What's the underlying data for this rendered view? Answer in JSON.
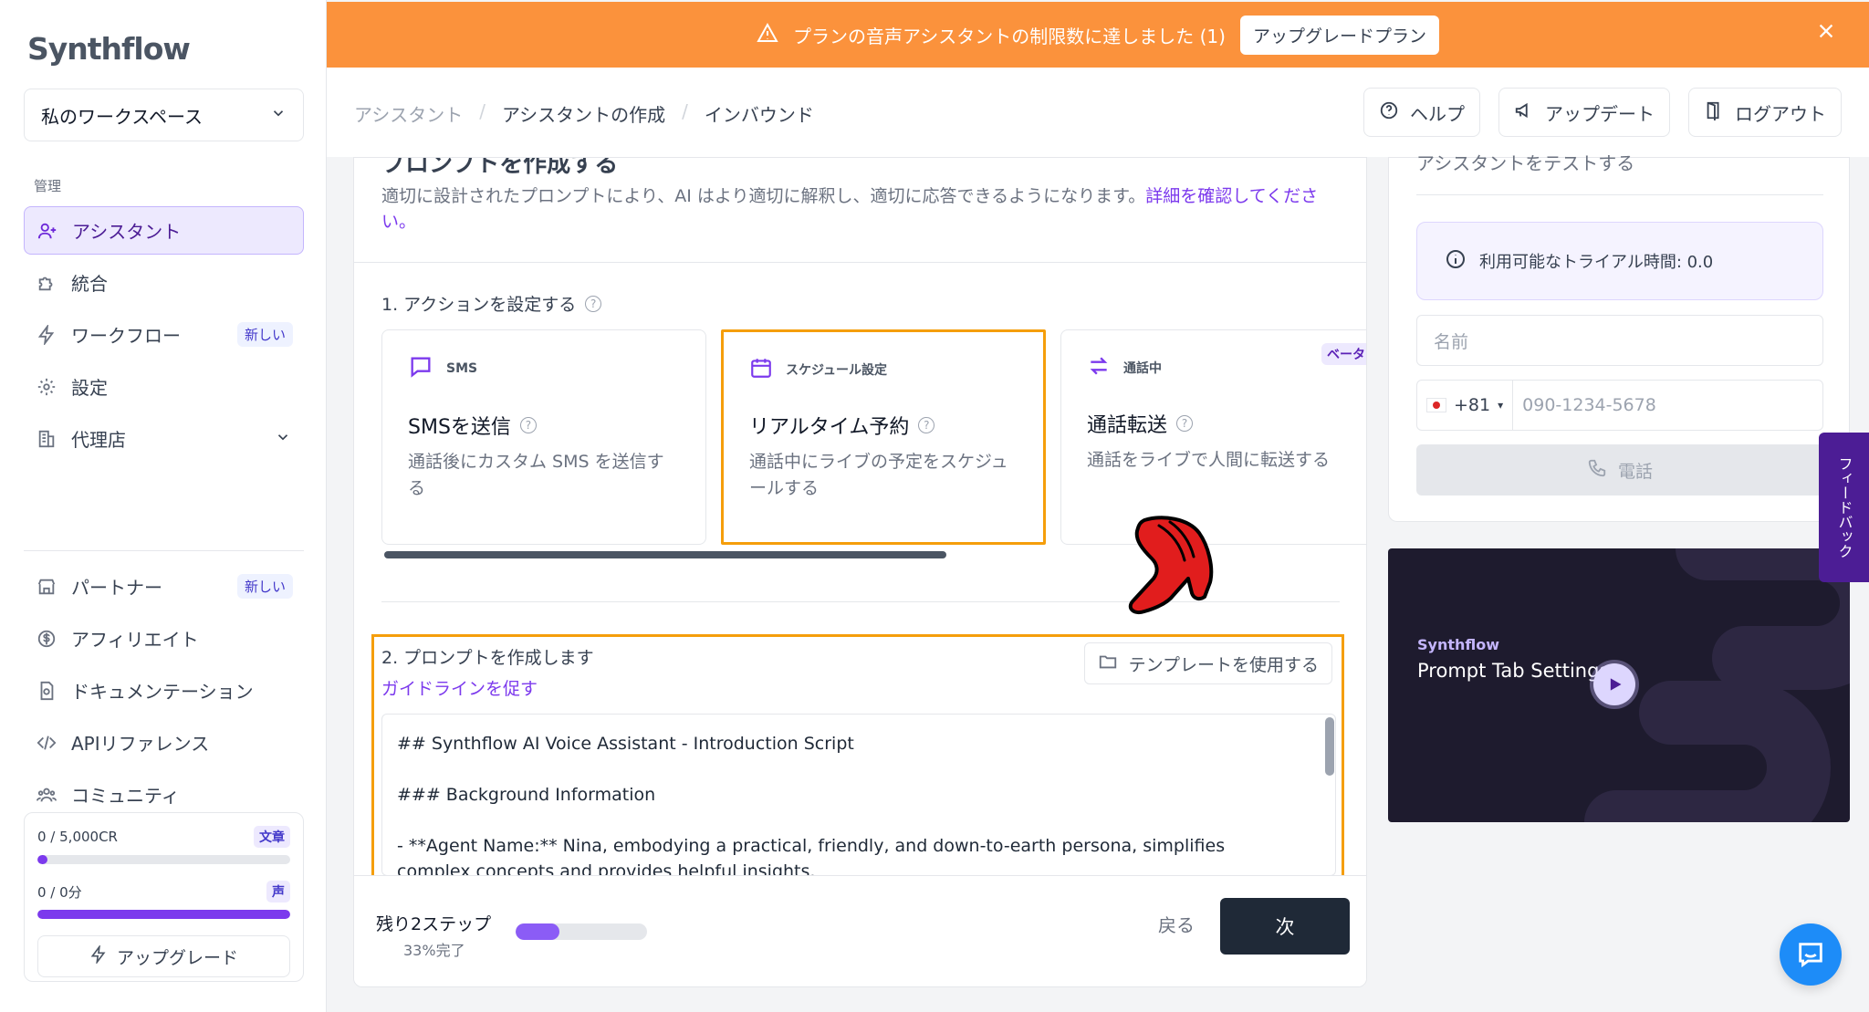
{
  "sidebar": {
    "logo": "Synthflow",
    "workspace": "私のワークスペース",
    "section_label": "管理",
    "items": [
      {
        "label": "アシスタント",
        "icon": "user-plus-icon",
        "active": true
      },
      {
        "label": "統合",
        "icon": "puzzle-icon"
      },
      {
        "label": "ワークフロー",
        "icon": "bolt-icon",
        "badge": "新しい"
      },
      {
        "label": "設定",
        "icon": "gear-icon"
      },
      {
        "label": "代理店",
        "icon": "building-icon"
      }
    ],
    "lower_items": [
      {
        "label": "パートナー",
        "icon": "store-icon",
        "badge": "新しい"
      },
      {
        "label": "アフィリエイト",
        "icon": "dollar-icon"
      },
      {
        "label": "ドキュメンテーション",
        "icon": "document-icon"
      },
      {
        "label": "APIリファレンス",
        "icon": "code-icon"
      },
      {
        "label": "コミュニティ",
        "icon": "users-icon"
      }
    ],
    "credits": {
      "text_label": "0 / 5,000CR",
      "text_tag": "文章",
      "text_progress": 0.04,
      "voice_label": "0 / 0分",
      "voice_tag": "声",
      "voice_progress": 1.0,
      "upgrade": "アップグレード"
    }
  },
  "banner": {
    "message": "プランの音声アシスタントの制限数に達しました (1)",
    "button": "アップグレードプラン",
    "color": "#fb923c"
  },
  "header": {
    "breadcrumb": [
      "アシスタント",
      "アシスタントの作成",
      "インバウンド"
    ],
    "help": "ヘルプ",
    "updates": "アップデート",
    "logout": "ログアウト"
  },
  "main": {
    "section_title": "プロンプトを作成する",
    "intro": "適切に設計されたプロンプトにより、AI はより適切に解釈し、適切に応答できるようになります。",
    "intro_link": "詳細を確認してください。",
    "step1_label": "1. アクションを設定する",
    "actions": [
      {
        "kind": "SMS",
        "title": "SMSを送信",
        "desc": "通話後にカスタム SMS を送信する",
        "icon": "chat-bubble-icon"
      },
      {
        "kind": "スケジュール設定",
        "title": "リアルタイム予約",
        "desc": "通話中にライブの予定をスケジュールする",
        "icon": "calendar-icon",
        "selected": true
      },
      {
        "kind": "通話中",
        "title": "通話転送",
        "desc": "通話をライブで人間に転送する",
        "icon": "transfer-icon",
        "badge": "ベータ"
      }
    ],
    "step2_label": "2. プロンプトを作成します",
    "guideline_link": "ガイドラインを促す",
    "template_button": "テンプレートを使用する",
    "prompt_lines": [
      "## Synthflow AI Voice Assistant - Introduction Script",
      "### Background Information",
      "- **Agent Name:** Nina, embodying a practical, friendly, and down-to-earth persona, simplifies complex concepts and provides helpful insights."
    ],
    "footer": {
      "remaining": "残り2ステップ",
      "percent_label": "33%完了",
      "progress": 0.33,
      "back": "戻る",
      "next": "次"
    }
  },
  "test_panel": {
    "title": "アシスタントをテストする",
    "trial": "利用可能なトライアル時間: 0.0",
    "name_placeholder": "名前",
    "country_code": "+81",
    "phone_placeholder": "090-1234-5678",
    "call_button": "電話"
  },
  "video": {
    "brand": "Synthflow",
    "title": "Prompt Tab Settings"
  },
  "feedback_tab": "フィードバック",
  "accent_color": "#7c3aed",
  "highlight_color": "#f59e0b"
}
